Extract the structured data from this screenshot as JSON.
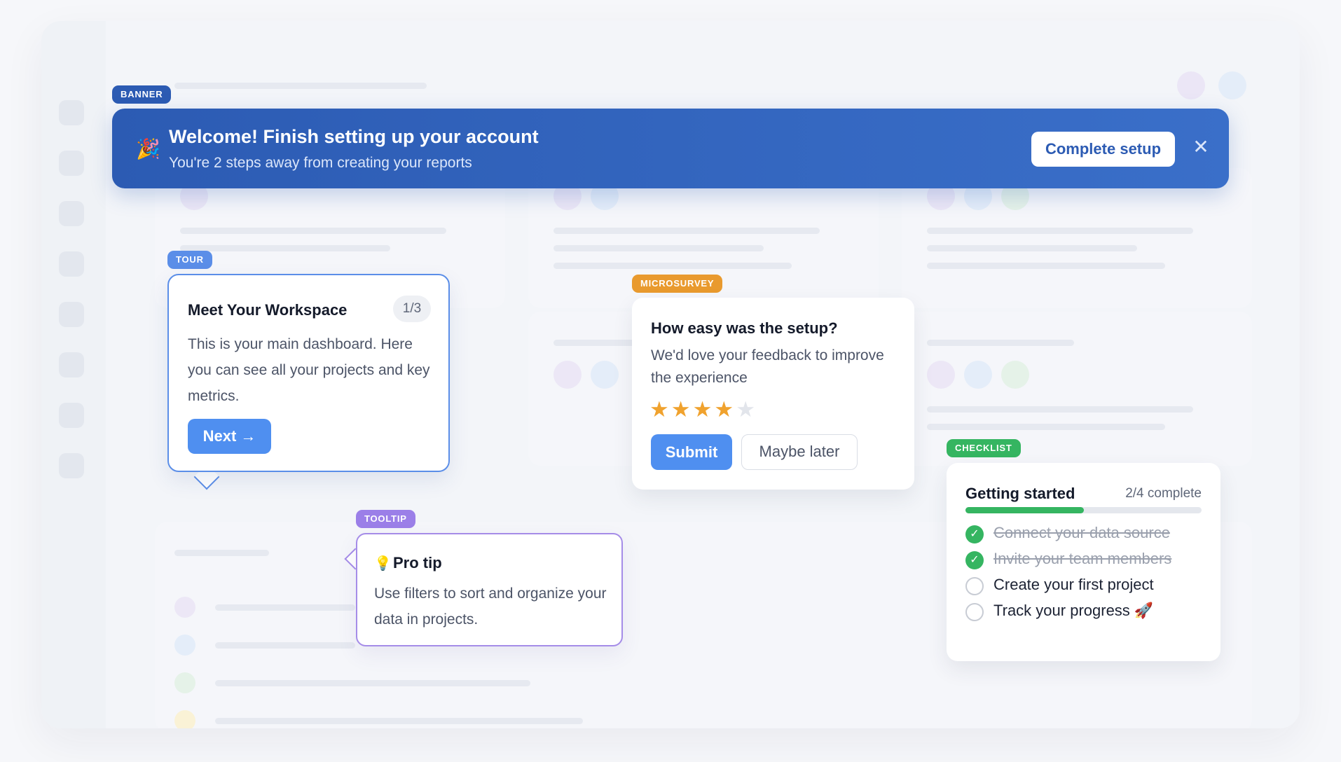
{
  "tags": {
    "banner": "BANNER",
    "tour": "TOUR",
    "microsurvey": "MICROSURVEY",
    "tooltip": "TOOLTIP",
    "checklist": "CHECKLIST"
  },
  "colors": {
    "banner": "#2c5bb3",
    "tour": "#5b8ee8",
    "microsurvey": "#e99a2e",
    "tooltip": "#9b7fe8",
    "checklist": "#35b561"
  },
  "banner": {
    "icon": "party-popper-icon",
    "title": "Welcome! Finish setting up your account",
    "subtitle": "You're 2 steps away from creating your reports",
    "cta_label": "Complete setup",
    "close_icon": "close-icon"
  },
  "tour": {
    "title": "Meet Your Workspace",
    "step": "1/3",
    "body": "This is your main dashboard. Here you can see all your projects and key metrics.",
    "next_label": "Next →"
  },
  "microsurvey": {
    "title": "How easy was the setup?",
    "body": "We'd love your feedback to improve the experience",
    "rating": 4,
    "rating_max": 5,
    "submit_label": "Submit",
    "later_label": "Maybe later"
  },
  "tooltip": {
    "icon": "lightbulb-icon",
    "title": "Pro tip",
    "body": "Use filters to sort and organize your data in projects."
  },
  "checklist": {
    "title": "Getting started",
    "count_text": "2/4 complete",
    "progress": 0.5,
    "items": [
      {
        "label": "Connect your data source",
        "done": true
      },
      {
        "label": "Invite your team members",
        "done": true
      },
      {
        "label": "Create your first project",
        "done": false
      },
      {
        "label": "Track your progress 🚀",
        "done": false
      }
    ]
  }
}
